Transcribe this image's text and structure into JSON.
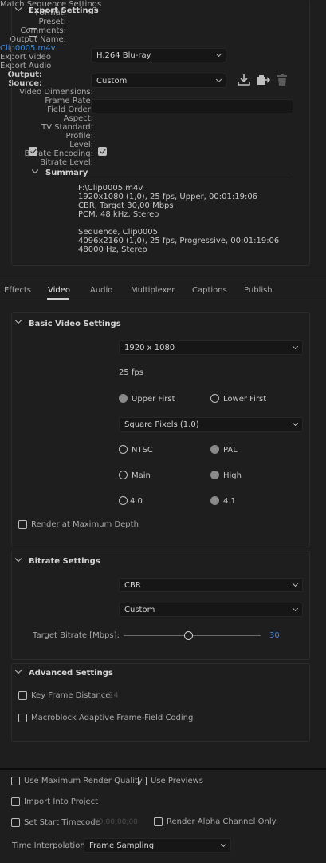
{
  "export_settings": {
    "title": "Export Settings",
    "match_sequence_label": "Match Sequence Settings",
    "format_label": "Format:",
    "format_value": "H.264 Blu-ray",
    "preset_label": "Preset:",
    "preset_value": "Custom",
    "comments_label": "Comments:",
    "comments_value": "",
    "output_name_label": "Output Name:",
    "output_name_value": "Clip0005.m4v",
    "export_video_label": "Export Video",
    "export_audio_label": "Export Audio",
    "summary": {
      "title": "Summary",
      "output_label": "Output:",
      "output_lines": [
        "F:\\Clip0005.m4v",
        "1920x1080 (1,0), 25 fps, Upper, 00:01:19:06",
        "CBR, Target 30,00 Mbps",
        "PCM, 48 kHz, Stereo"
      ],
      "source_label": "Source:",
      "source_lines": [
        "Sequence, Clip0005",
        "4096x2160 (1,0), 25 fps, Progressive, 00:01:19:06",
        "48000 Hz, Stereo"
      ]
    }
  },
  "tabs": [
    "Effects",
    "Video",
    "Audio",
    "Multiplexer",
    "Captions",
    "Publish"
  ],
  "basic_video": {
    "title": "Basic Video Settings",
    "dimensions_label": "Video Dimensions:",
    "dimensions_value": "1920 x 1080",
    "frame_rate_label": "Frame Rate:",
    "frame_rate_value": "25 fps",
    "field_order_label": "Field Order:",
    "field_order_upper": "Upper First",
    "field_order_lower": "Lower First",
    "aspect_label": "Aspect:",
    "aspect_value": "Square Pixels (1.0)",
    "tv_standard_label": "TV Standard:",
    "tv_ntsc": "NTSC",
    "tv_pal": "PAL",
    "profile_label": "Profile:",
    "profile_main": "Main",
    "profile_high": "High",
    "level_label": "Level:",
    "level_a": "4.0",
    "level_b": "4.1",
    "render_max_depth_label": "Render at Maximum Depth"
  },
  "bitrate": {
    "title": "Bitrate Settings",
    "encoding_label": "Bitrate Encoding:",
    "encoding_value": "CBR",
    "level_label": "Bitrate Level:",
    "level_value": "Custom",
    "target_label": "Target Bitrate [Mbps]:",
    "target_value": "30"
  },
  "advanced": {
    "title": "Advanced Settings",
    "key_frame_label": "Key Frame Distance:",
    "key_frame_value": "24",
    "macroblock_label": "Macroblock Adaptive Frame-Field Coding"
  },
  "footer": {
    "max_render_quality": "Use Maximum Render Quality",
    "use_previews": "Use Previews",
    "import_project": "Import Into Project",
    "set_start_timecode": "Set Start Timecode",
    "timecode_value": "00;00;00;00",
    "render_alpha": "Render Alpha Channel Only",
    "time_interp_label": "Time Interpolation:",
    "time_interp_value": "Frame Sampling"
  },
  "colors": {
    "accent_link": "#3f88d9",
    "background": "#1e1e1e"
  }
}
